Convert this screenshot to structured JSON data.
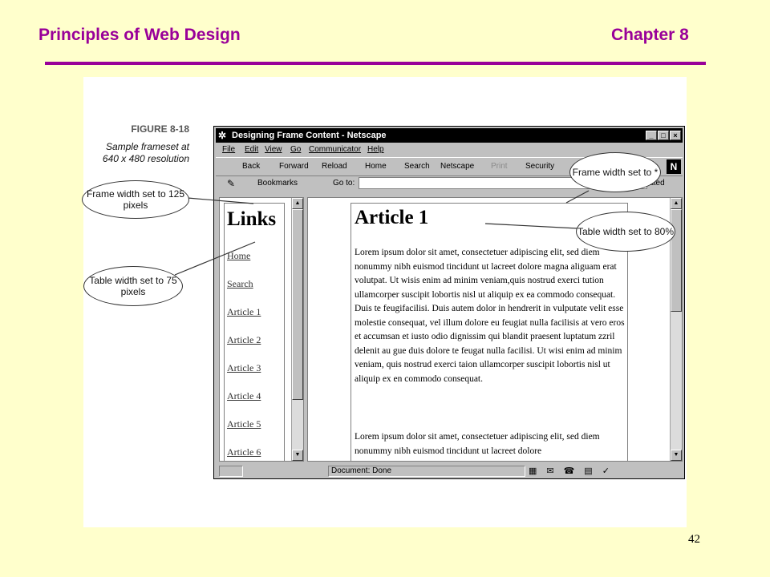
{
  "slide": {
    "title": "Principles of Web Design",
    "chapter": "Chapter 8",
    "page_number": "42",
    "accent_color": "#990099",
    "background_color": "#ffffcc"
  },
  "figure": {
    "label": "FIGURE 8-18",
    "caption": "Sample frameset at 640 x 480 resolution"
  },
  "window": {
    "title": "Designing Frame Content - Netscape",
    "icon": "netscape-app-icon",
    "controls": [
      "_",
      "□",
      "×"
    ],
    "menu": [
      "File",
      "Edit",
      "View",
      "Go",
      "Communicator",
      "Help"
    ],
    "toolbar": [
      {
        "label": "Back",
        "enabled": true
      },
      {
        "label": "Forward",
        "enabled": true
      },
      {
        "label": "Reload",
        "enabled": true
      },
      {
        "label": "Home",
        "enabled": true
      },
      {
        "label": "Search",
        "enabled": true
      },
      {
        "label": "Netscape",
        "enabled": true
      },
      {
        "label": "Print",
        "enabled": false
      },
      {
        "label": "Security",
        "enabled": true
      }
    ],
    "logo": "N",
    "location": {
      "bookmarks_label": "Bookmarks",
      "goto_label": "Go to:",
      "value": "",
      "related_label": "lated"
    },
    "status": {
      "text": "Document: Done"
    }
  },
  "left_frame": {
    "heading": "Links",
    "links": [
      "Home",
      "Search",
      "Article 1",
      "Article 2",
      "Article 3",
      "Article 4",
      "Article 5",
      "Article 6"
    ]
  },
  "right_frame": {
    "heading": "Article 1",
    "paragraphs": [
      "Lorem ipsum dolor sit amet, consectetuer adipiscing elit, sed diem nonummy nibh euismod tincidunt ut lacreet dolore magna aliguam erat volutpat. Ut wisis enim ad minim veniam,quis nostrud exerci tution ullamcorper suscipit lobortis nisl ut aliquip ex ea commodo consequat. Duis te feugifacilisi. Duis autem dolor in hendrerit in vulputate velit esse molestie consequat, vel illum dolore eu feugiat nulla facilisis at vero eros et accumsan et iusto odio dignissim qui blandit praesent luptatum zzril delenit au gue duis dolore te feugat nulla facilisi. Ut wisi enim ad minim veniam, quis nostrud exerci taion ullamcorper suscipit lobortis nisl ut aliquip ex en commodo consequat.",
      "Lorem ipsum dolor sit amet, consectetuer adipiscing elit, sed diem nonummy nibh euismod tincidunt ut lacreet dolore"
    ]
  },
  "callouts": {
    "frame_width_125": "Frame width set to 125 pixels",
    "table_width_75": "Table width set to 75 pixels",
    "frame_width_star": "Frame width set to *",
    "table_width_80": "Table width set to 80%"
  }
}
